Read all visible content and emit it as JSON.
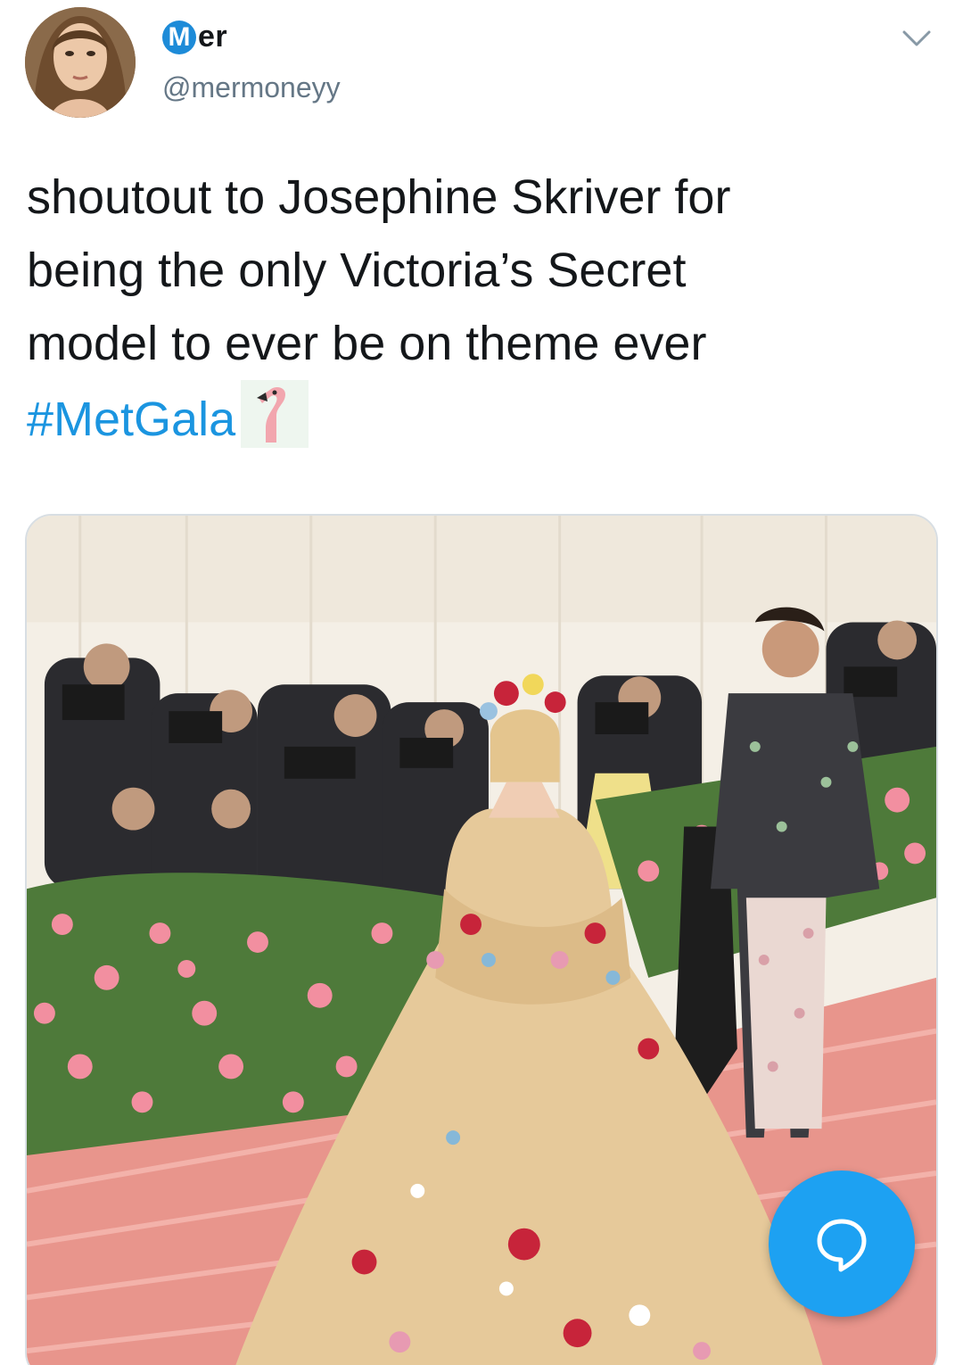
{
  "author": {
    "badge_letter": "M",
    "display_name_rest": "er",
    "handle": "@mermoneyy"
  },
  "tweet": {
    "lines": [
      "shoutout to Josephine Skriver for",
      "being the only Victoria’s Secret",
      "model to ever be on theme ever"
    ],
    "hashtag": "#MetGala",
    "emoji": "flamingo-emoji"
  },
  "media": {
    "description_icon": "photo",
    "colors": {
      "stairs": "#e8958c",
      "flowers": "#f28fa0",
      "foliage": "#4e7a3a",
      "gown": "#e6c99a",
      "tent": "#f4efe6"
    }
  },
  "icons": {
    "menu": "chevron-down-icon",
    "compose": "reply-bubble-icon"
  },
  "colors": {
    "accent": "#1da1f2",
    "link": "#1b95e0",
    "badge": "#1d8bd8",
    "secondary_text": "#657786"
  }
}
